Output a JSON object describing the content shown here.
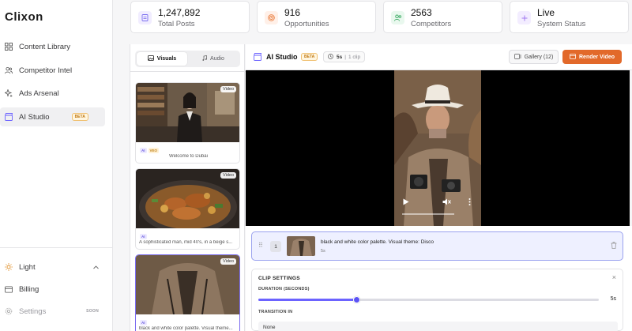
{
  "app": {
    "logo": "Clixon"
  },
  "sidebar": {
    "items": [
      {
        "label": "Content Library",
        "icon": "grid-icon"
      },
      {
        "label": "Competitor Intel",
        "icon": "users-icon"
      },
      {
        "label": "Ads Arsenal",
        "icon": "sparkles-icon"
      },
      {
        "label": "AI Studio",
        "icon": "clapper-icon",
        "badge": "BETA",
        "active": true
      }
    ],
    "bottom": [
      {
        "label": "Light",
        "icon": "sun-icon"
      },
      {
        "label": "Billing",
        "icon": "card-icon"
      },
      {
        "label": "Settings",
        "icon": "gear-icon",
        "badge": "SOON"
      }
    ]
  },
  "stats": [
    {
      "value": "1,247,892",
      "label": "Total Posts",
      "color": "#f1edff",
      "icon_color": "#7b6ff0",
      "icon": "file-icon"
    },
    {
      "value": "916",
      "label": "Opportunities",
      "color": "#fff0e8",
      "icon_color": "#ea7c3c",
      "icon": "target-icon"
    },
    {
      "value": "2563",
      "label": "Competitors",
      "color": "#e9f8ee",
      "icon_color": "#3caa64",
      "icon": "users-icon"
    },
    {
      "value": "Live",
      "label": "System Status",
      "color": "#f3edff",
      "icon_color": "#9a6ff0",
      "icon": "plus-icon"
    }
  ],
  "media_panel": {
    "tabs": {
      "visuals": "Visuals",
      "audio": "Audio"
    },
    "cards": [
      {
        "badge": "Video",
        "chips": [
          "AI",
          "VEO"
        ],
        "caption": "Welcome to Dubai"
      },
      {
        "badge": "Video",
        "chips": [
          "AI"
        ],
        "caption": "A sophisticated man, mid 40's, in a beige s..."
      },
      {
        "badge": "Video",
        "chips": [
          "AI"
        ],
        "caption": "black and white color palette. Visual theme..."
      }
    ]
  },
  "studio": {
    "title": "AI Studio",
    "beta": "BETA",
    "duration": "5s",
    "clips_count": "1 clip",
    "gallery_label": "Gallery (12)",
    "render_label": "Render Video"
  },
  "clip": {
    "number": "1",
    "title": "black and white color palette. Visual theme: Disco",
    "duration": "5s"
  },
  "clip_settings": {
    "title": "CLIP SETTINGS",
    "duration_label": "DURATION (SECONDS)",
    "duration_value": "5s",
    "duration_fraction": 0.29,
    "transition_label": "TRANSITION IN",
    "transition_value": "None"
  },
  "colors": {
    "accent": "#e2692a",
    "brand": "#6c63ff"
  }
}
